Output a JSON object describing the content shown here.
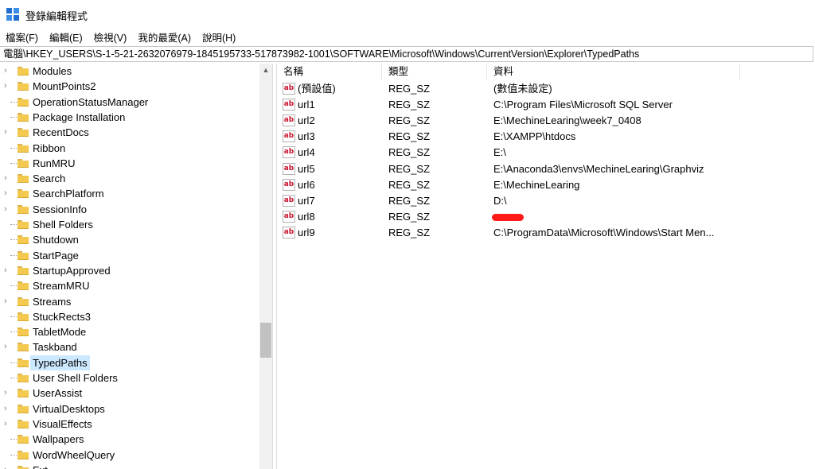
{
  "window": {
    "title": "登錄編輯程式",
    "app_icon": "regedit-icon"
  },
  "menu": [
    "檔案(F)",
    "編輯(E)",
    "檢視(V)",
    "我的最愛(A)",
    "說明(H)"
  ],
  "address": "電腦\\HKEY_USERS\\S-1-5-21-2632076979-1845195733-517873982-1001\\SOFTWARE\\Microsoft\\Windows\\CurrentVersion\\Explorer\\TypedPaths",
  "tree": {
    "items": [
      {
        "label": "Modules",
        "expandable": true,
        "selected": false
      },
      {
        "label": "MountPoints2",
        "expandable": true,
        "selected": false
      },
      {
        "label": "OperationStatusManager",
        "expandable": false,
        "selected": false
      },
      {
        "label": "Package Installation",
        "expandable": false,
        "selected": false
      },
      {
        "label": "RecentDocs",
        "expandable": true,
        "selected": false
      },
      {
        "label": "Ribbon",
        "expandable": false,
        "selected": false
      },
      {
        "label": "RunMRU",
        "expandable": false,
        "selected": false
      },
      {
        "label": "Search",
        "expandable": true,
        "selected": false
      },
      {
        "label": "SearchPlatform",
        "expandable": true,
        "selected": false
      },
      {
        "label": "SessionInfo",
        "expandable": true,
        "selected": false
      },
      {
        "label": "Shell Folders",
        "expandable": false,
        "selected": false
      },
      {
        "label": "Shutdown",
        "expandable": false,
        "selected": false
      },
      {
        "label": "StartPage",
        "expandable": false,
        "selected": false
      },
      {
        "label": "StartupApproved",
        "expandable": true,
        "selected": false
      },
      {
        "label": "StreamMRU",
        "expandable": false,
        "selected": false
      },
      {
        "label": "Streams",
        "expandable": true,
        "selected": false
      },
      {
        "label": "StuckRects3",
        "expandable": false,
        "selected": false
      },
      {
        "label": "TabletMode",
        "expandable": false,
        "selected": false
      },
      {
        "label": "Taskband",
        "expandable": true,
        "selected": false
      },
      {
        "label": "TypedPaths",
        "expandable": false,
        "selected": true
      },
      {
        "label": "User Shell Folders",
        "expandable": false,
        "selected": false
      },
      {
        "label": "UserAssist",
        "expandable": true,
        "selected": false
      },
      {
        "label": "VirtualDesktops",
        "expandable": true,
        "selected": false
      },
      {
        "label": "VisualEffects",
        "expandable": true,
        "selected": false
      },
      {
        "label": "Wallpapers",
        "expandable": false,
        "selected": false
      },
      {
        "label": "WordWheelQuery",
        "expandable": false,
        "selected": false
      },
      {
        "label": "Ext",
        "expandable": true,
        "selected": false
      }
    ],
    "selected_color": "#cce8ff",
    "folder_icon": "folder-icon"
  },
  "list": {
    "columns": [
      "名稱",
      "類型",
      "資料"
    ],
    "rows": [
      {
        "name": "(預設值)",
        "type": "REG_SZ",
        "data": "(數值未設定)",
        "redacted": false
      },
      {
        "name": "url1",
        "type": "REG_SZ",
        "data": "C:\\Program Files\\Microsoft SQL Server",
        "redacted": false
      },
      {
        "name": "url2",
        "type": "REG_SZ",
        "data": "E:\\MechineLearing\\week7_0408",
        "redacted": false
      },
      {
        "name": "url3",
        "type": "REG_SZ",
        "data": "E:\\XAMPP\\htdocs",
        "redacted": false
      },
      {
        "name": "url4",
        "type": "REG_SZ",
        "data": "E:\\",
        "redacted": false
      },
      {
        "name": "url5",
        "type": "REG_SZ",
        "data": "E:\\Anaconda3\\envs\\MechineLearing\\Graphviz",
        "redacted": false
      },
      {
        "name": "url6",
        "type": "REG_SZ",
        "data": "E:\\MechineLearing",
        "redacted": false
      },
      {
        "name": "url7",
        "type": "REG_SZ",
        "data": "D:\\",
        "redacted": false
      },
      {
        "name": "url8",
        "type": "REG_SZ",
        "data": "",
        "redacted": true
      },
      {
        "name": "url9",
        "type": "REG_SZ",
        "data": "C:\\ProgramData\\Microsoft\\Windows\\Start Men...",
        "redacted": false
      }
    ],
    "value_icon": "string-value-icon",
    "value_icon_text": "ab",
    "redaction_color": "#ff1a1a"
  }
}
